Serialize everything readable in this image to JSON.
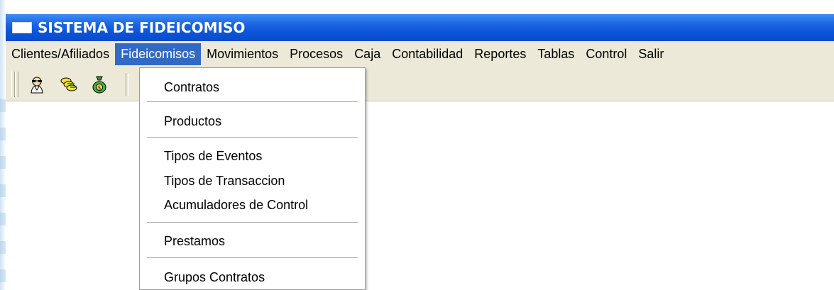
{
  "window": {
    "title": "SISTEMA DE FIDEICOMISO"
  },
  "menubar": {
    "items": [
      {
        "label": "Clientes/Afiliados"
      },
      {
        "label": "Fideicomisos"
      },
      {
        "label": "Movimientos"
      },
      {
        "label": "Procesos"
      },
      {
        "label": "Caja"
      },
      {
        "label": "Contabilidad"
      },
      {
        "label": "Reportes"
      },
      {
        "label": "Tablas"
      },
      {
        "label": "Control"
      },
      {
        "label": "Salir"
      }
    ],
    "active_item": "Fideicomisos"
  },
  "toolbar": {
    "buttons": [
      {
        "icon": "person-glasses-icon"
      },
      {
        "icon": "stacked-coins-icon"
      },
      {
        "icon": "money-bag-icon"
      }
    ]
  },
  "dropdown": {
    "items": {
      "contratos": "Contratos",
      "productos": "Productos",
      "tipos_eventos": "Tipos de Eventos",
      "tipos_transaccion": "Tipos de Transaccion",
      "acumuladores": "Acumuladores de Control",
      "prestamos": "Prestamos",
      "grupos_contratos": "Grupos Contratos"
    }
  },
  "colors": {
    "titlebar": "#0b53d6",
    "menu_highlight": "#316ac5",
    "chrome": "#ece9d8"
  }
}
